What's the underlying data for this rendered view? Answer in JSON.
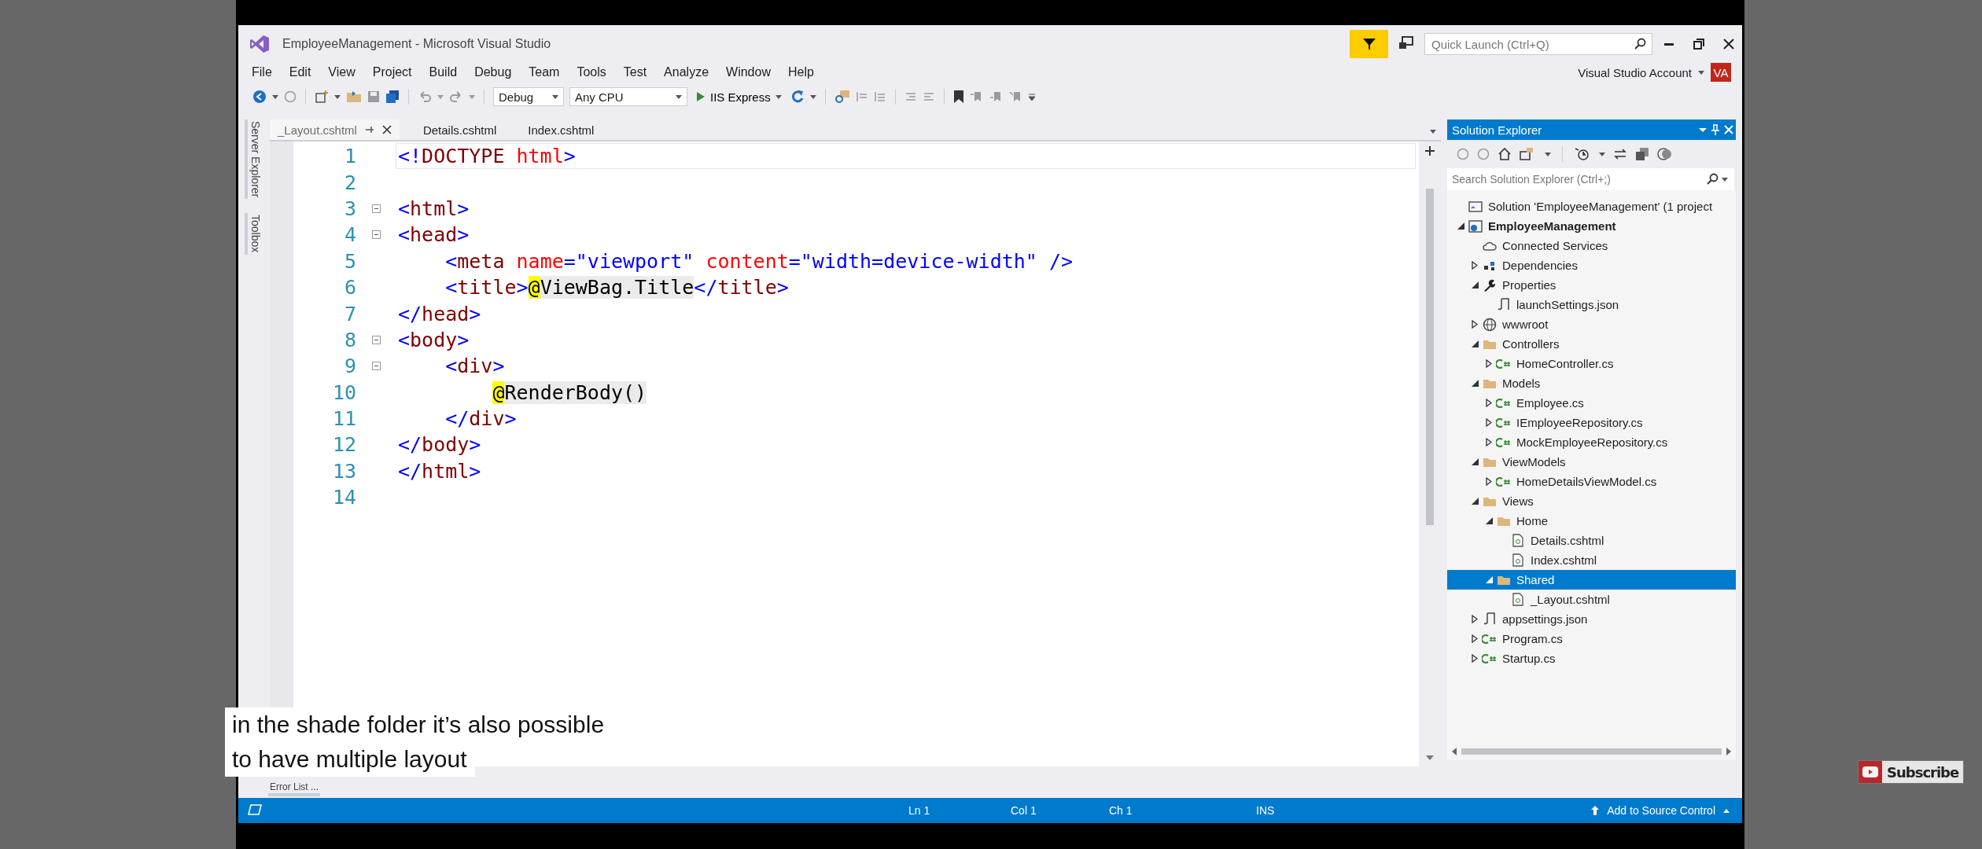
{
  "window": {
    "title": "EmployeeManagement - Microsoft Visual Studio",
    "quick_launch": {
      "placeholder": "Quick Launch (Ctrl+Q)"
    },
    "account": "Visual Studio Account",
    "avatar": "VA"
  },
  "menu": [
    "File",
    "Edit",
    "View",
    "Project",
    "Build",
    "Debug",
    "Team",
    "Tools",
    "Test",
    "Analyze",
    "Window",
    "Help"
  ],
  "toolbar": {
    "configuration": "Debug",
    "platform": "Any CPU",
    "run_target": "IIS Express"
  },
  "side_tabs": [
    "Server Explorer",
    "Toolbox"
  ],
  "tabs": [
    {
      "label": "_Layout.cshtml",
      "selected": true
    },
    {
      "label": "Details.cshtml",
      "selected": false
    },
    {
      "label": "Index.cshtml",
      "selected": false
    }
  ],
  "editor": {
    "lines": [
      {
        "number": "1",
        "fold": false,
        "current": true,
        "tokens": [
          {
            "kind": "delim",
            "text": "<!"
          },
          {
            "kind": "tag",
            "text": "DOCTYPE"
          },
          {
            "kind": "attr",
            "text": " html"
          },
          {
            "kind": "delim",
            "text": ">"
          }
        ]
      },
      {
        "number": "2",
        "fold": false,
        "current": false
      },
      {
        "number": "3",
        "fold": true,
        "current": false,
        "tokens": [
          {
            "kind": "delim",
            "text": "<"
          },
          {
            "kind": "tag",
            "text": "html"
          },
          {
            "kind": "delim",
            "text": ">"
          }
        ]
      },
      {
        "number": "4",
        "fold": true,
        "current": false,
        "tokens": [
          {
            "kind": "delim",
            "text": "<"
          },
          {
            "kind": "tag",
            "text": "head"
          },
          {
            "kind": "delim",
            "text": ">"
          }
        ]
      },
      {
        "number": "5",
        "fold": false,
        "current": false,
        "tokens": [
          {
            "kind": "delim",
            "text": "    <"
          },
          {
            "kind": "tag",
            "text": "meta"
          },
          {
            "kind": "attr",
            "text": " name"
          },
          {
            "kind": "delim",
            "text": "="
          },
          {
            "kind": "value",
            "text": "\"viewport\""
          },
          {
            "kind": "attr",
            "text": " content"
          },
          {
            "kind": "delim",
            "text": "="
          },
          {
            "kind": "value",
            "text": "\"width=device-width\""
          },
          {
            "kind": "delim",
            "text": " />"
          }
        ]
      },
      {
        "number": "6",
        "fold": false,
        "current": false,
        "tokens": [
          {
            "kind": "delim",
            "text": "    <"
          },
          {
            "kind": "tag",
            "text": "title"
          },
          {
            "kind": "delim",
            "text": ">"
          },
          {
            "kind": "razor_at",
            "text": "@"
          },
          {
            "kind": "razor",
            "text": "ViewBag.Title"
          },
          {
            "kind": "delim",
            "text": "</"
          },
          {
            "kind": "tag",
            "text": "title"
          },
          {
            "kind": "delim",
            "text": ">"
          }
        ]
      },
      {
        "number": "7",
        "fold": false,
        "current": false,
        "tokens": [
          {
            "kind": "delim",
            "text": "</"
          },
          {
            "kind": "tag",
            "text": "head"
          },
          {
            "kind": "delim",
            "text": ">"
          }
        ]
      },
      {
        "number": "8",
        "fold": true,
        "current": false,
        "tokens": [
          {
            "kind": "delim",
            "text": "<"
          },
          {
            "kind": "tag",
            "text": "body"
          },
          {
            "kind": "delim",
            "text": ">"
          }
        ]
      },
      {
        "number": "9",
        "fold": true,
        "current": false,
        "tokens": [
          {
            "kind": "delim",
            "text": "    <"
          },
          {
            "kind": "tag",
            "text": "div"
          },
          {
            "kind": "delim",
            "text": ">"
          }
        ]
      },
      {
        "number": "10",
        "fold": false,
        "current": false,
        "tokens": [
          {
            "kind": "razor_at",
            "text": "        @"
          },
          {
            "kind": "razor",
            "text": "RenderBody()"
          }
        ]
      },
      {
        "number": "11",
        "fold": false,
        "current": false,
        "tokens": [
          {
            "kind": "delim",
            "text": "    </"
          },
          {
            "kind": "tag",
            "text": "div"
          },
          {
            "kind": "delim",
            "text": ">"
          }
        ]
      },
      {
        "number": "12",
        "fold": false,
        "current": false,
        "tokens": [
          {
            "kind": "delim",
            "text": "</"
          },
          {
            "kind": "tag",
            "text": "body"
          },
          {
            "kind": "delim",
            "text": ">"
          }
        ]
      },
      {
        "number": "13",
        "fold": false,
        "current": false,
        "tokens": [
          {
            "kind": "delim",
            "text": "</"
          },
          {
            "kind": "tag",
            "text": "html"
          },
          {
            "kind": "delim",
            "text": ">"
          }
        ]
      },
      {
        "number": "14",
        "fold": false,
        "current": false
      }
    ]
  },
  "bottom_tab": "Error List ...",
  "solution_explorer": {
    "title": "Solution Explorer",
    "search": {
      "placeholder": "Search Solution Explorer (Ctrl+;)"
    },
    "tree": [
      {
        "label": "Solution 'EmployeeManagement' (1 project",
        "kind": "solution",
        "selected": false
      },
      {
        "label": "EmployeeManagement",
        "kind": "project",
        "expanded": true,
        "selected": false,
        "children": [
          {
            "label": "Connected Services",
            "kind": "service",
            "selected": false
          },
          {
            "label": "Dependencies",
            "kind": "dependencies",
            "expanded": false,
            "selected": false
          },
          {
            "label": "Properties",
            "kind": "properties",
            "expanded": true,
            "selected": false,
            "children": [
              {
                "label": "launchSettings.json",
                "kind": "json",
                "selected": false
              }
            ]
          },
          {
            "label": "wwwroot",
            "kind": "web",
            "expanded": false,
            "selected": false
          },
          {
            "label": "Controllers",
            "kind": "folder",
            "expanded": true,
            "selected": false,
            "children": [
              {
                "label": "HomeController.cs",
                "kind": "csharp",
                "expanded": false,
                "selected": false
              }
            ]
          },
          {
            "label": "Models",
            "kind": "folder",
            "expanded": true,
            "selected": false,
            "children": [
              {
                "label": "Employee.cs",
                "kind": "csharp",
                "expanded": false,
                "selected": false
              },
              {
                "label": "IEmployeeRepository.cs",
                "kind": "csharp",
                "expanded": false,
                "selected": false
              },
              {
                "label": "MockEmployeeRepository.cs",
                "kind": "csharp",
                "expanded": false,
                "selected": false
              }
            ]
          },
          {
            "label": "ViewModels",
            "kind": "folder",
            "expanded": true,
            "selected": false,
            "children": [
              {
                "label": "HomeDetailsViewModel.cs",
                "kind": "csharp",
                "expanded": false,
                "selected": false
              }
            ]
          },
          {
            "label": "Views",
            "kind": "folder",
            "expanded": true,
            "selected": false,
            "children": [
              {
                "label": "Home",
                "kind": "folder",
                "expanded": true,
                "selected": false,
                "children": [
                  {
                    "label": "Details.cshtml",
                    "kind": "page",
                    "selected": false
                  },
                  {
                    "label": "Index.cshtml",
                    "kind": "page",
                    "selected": false
                  }
                ]
              },
              {
                "label": "Shared",
                "kind": "folder",
                "expanded": true,
                "selected": true,
                "children": [
                  {
                    "label": "_Layout.cshtml",
                    "kind": "page",
                    "selected": false
                  }
                ]
              }
            ]
          },
          {
            "label": "appsettings.json",
            "kind": "json",
            "expanded": false,
            "selected": false
          },
          {
            "label": "Program.cs",
            "kind": "csharp",
            "expanded": false,
            "selected": false
          },
          {
            "label": "Startup.cs",
            "kind": "csharp",
            "expanded": false,
            "selected": false
          }
        ]
      }
    ]
  },
  "status_bar": {
    "items": [
      "Ln 1",
      "Col 1",
      "Ch 1",
      "INS"
    ],
    "source_control": "Add to Source Control"
  },
  "captions": [
    "in the shade folder it’s also possible",
    "to have multiple layout"
  ],
  "subscribe": "Subscribe"
}
